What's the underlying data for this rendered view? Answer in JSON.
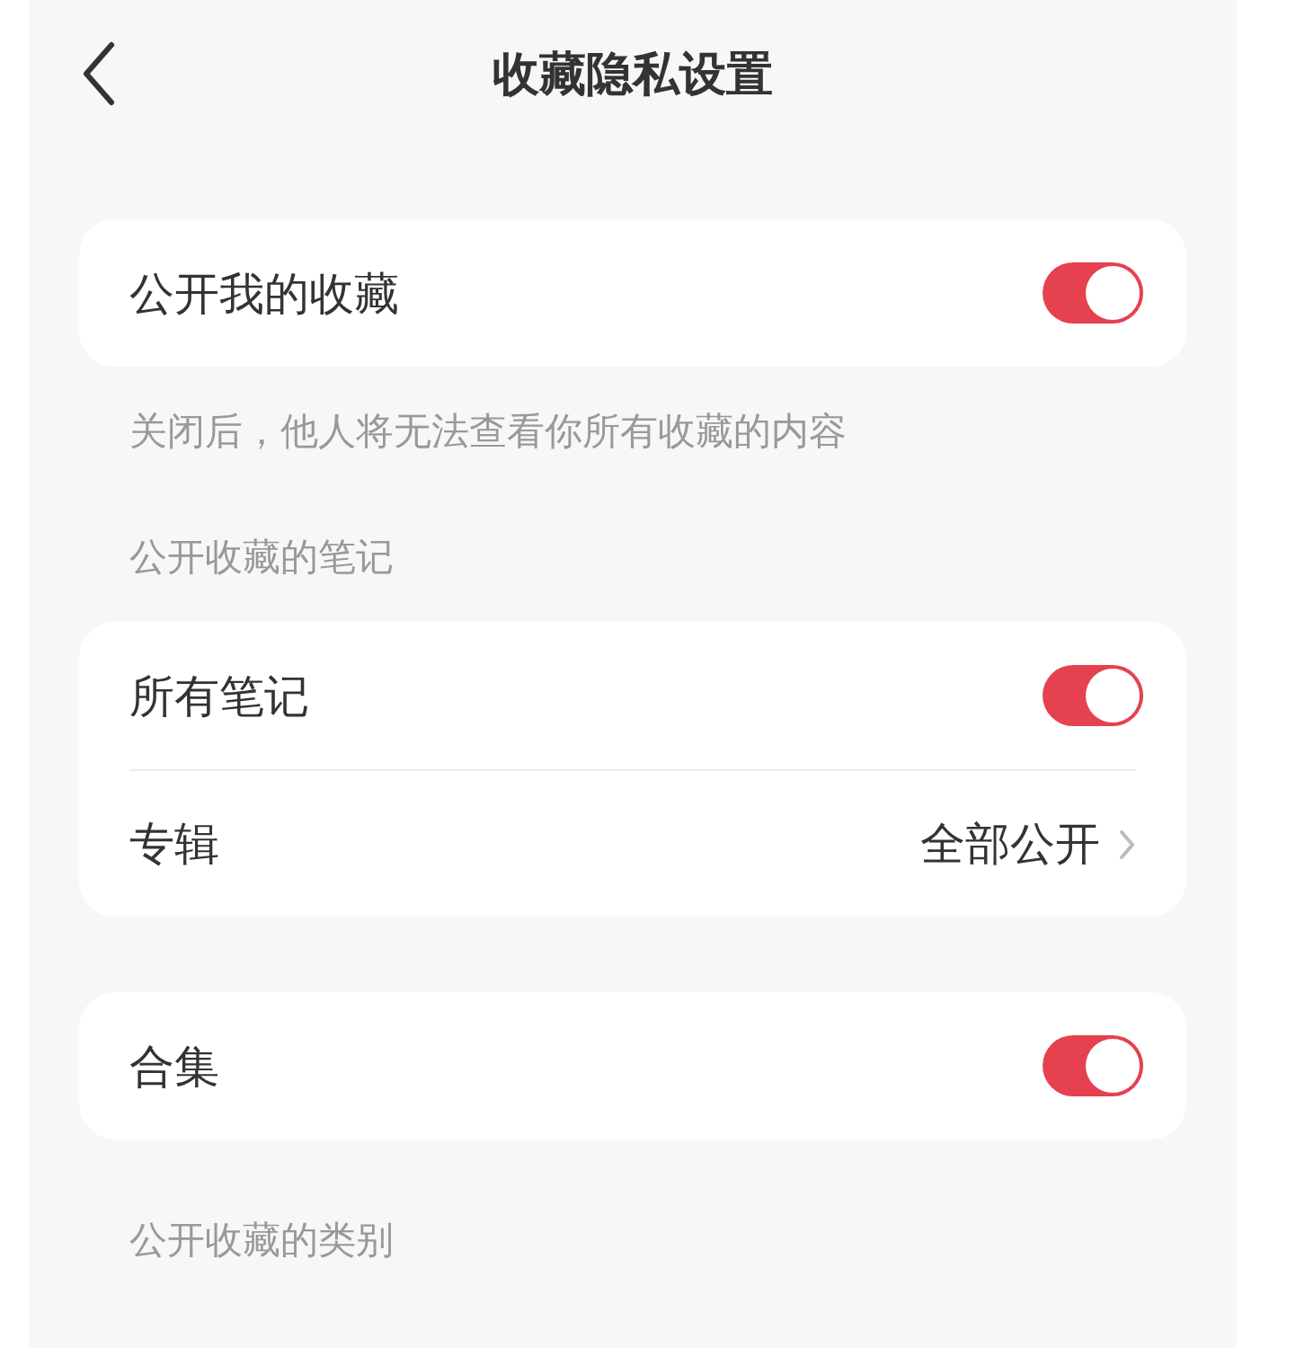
{
  "header": {
    "title": "收藏隐私设置"
  },
  "sections": [
    {
      "kind": "card",
      "rows": [
        {
          "kind": "toggle",
          "label": "公开我的收藏",
          "on": true
        }
      ]
    },
    {
      "kind": "note",
      "text": "关闭后，他人将无法查看你所有收藏的内容"
    },
    {
      "kind": "label",
      "text": "公开收藏的笔记"
    },
    {
      "kind": "card",
      "rows": [
        {
          "kind": "toggle",
          "label": "所有笔记",
          "on": true
        },
        {
          "kind": "link",
          "label": "专辑",
          "value": "全部公开"
        }
      ]
    },
    {
      "kind": "card",
      "rows": [
        {
          "kind": "toggle",
          "label": "合集",
          "on": true
        }
      ]
    },
    {
      "kind": "label",
      "text": "公开收藏的类别"
    }
  ]
}
